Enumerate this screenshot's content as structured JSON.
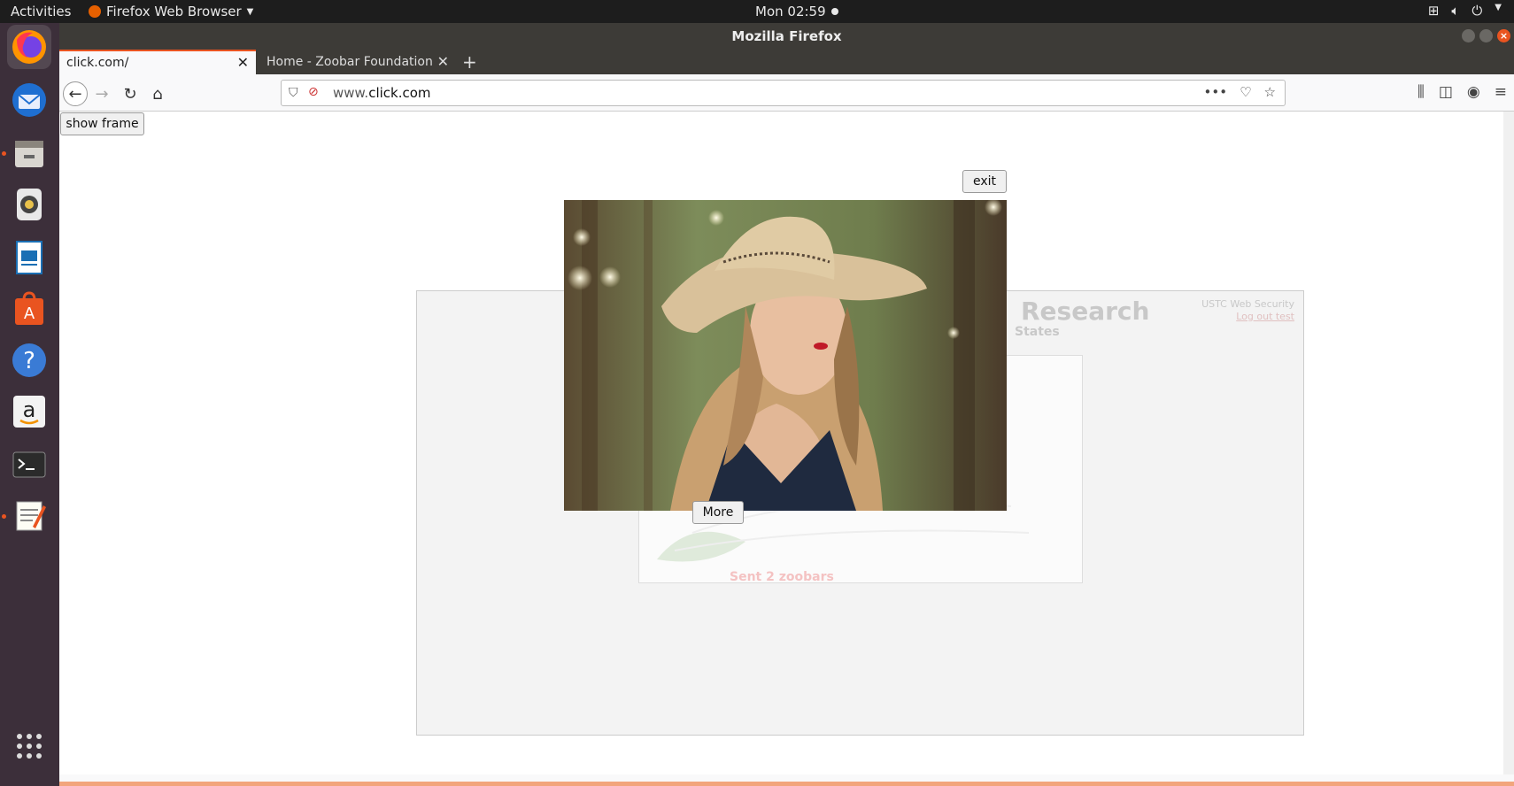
{
  "topbar": {
    "activities": "Activities",
    "app_menu": "Firefox Web Browser",
    "clock": "Mon 02:59"
  },
  "dock": {
    "items": [
      {
        "name": "firefox-icon"
      },
      {
        "name": "thunderbird-icon"
      },
      {
        "name": "files-icon"
      },
      {
        "name": "rhythmbox-icon"
      },
      {
        "name": "writer-icon"
      },
      {
        "name": "software-icon"
      },
      {
        "name": "help-icon"
      },
      {
        "name": "amazon-icon"
      },
      {
        "name": "terminal-icon"
      },
      {
        "name": "text-editor-icon"
      },
      {
        "name": "show-apps-icon"
      }
    ]
  },
  "window": {
    "title": "Mozilla Firefox"
  },
  "tabs": [
    {
      "label": "click.com/"
    },
    {
      "label": "Home - Zoobar Foundation"
    }
  ],
  "urlbar": {
    "prefix": "www.",
    "domain": "click.com"
  },
  "page": {
    "show_frame_label": "show frame",
    "exit_label": "exit",
    "more_label": "More",
    "frame": {
      "title_fragment": "Research",
      "subtitle_fragment": "States",
      "corner_line1": "USTC Web Security",
      "corner_line2": "Log out test",
      "sent_text": "Sent 2 zoobars"
    }
  },
  "colors": {
    "ubuntu_orange": "#e95420",
    "dock_bg": "#3c2f3a",
    "titlebar_bg": "#3d3b37"
  }
}
